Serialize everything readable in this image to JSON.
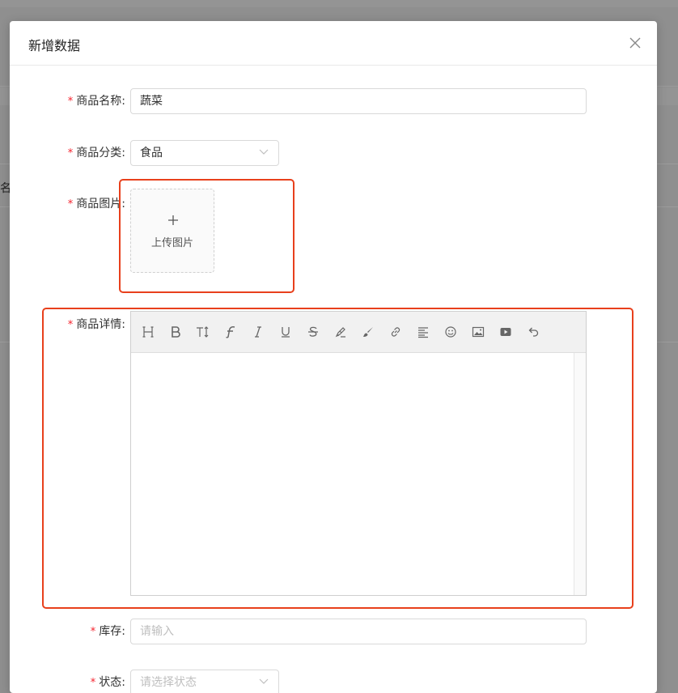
{
  "backdrop": {
    "fragment_text": "名"
  },
  "modal": {
    "title": "新增数据",
    "close_icon": "close-icon"
  },
  "form": {
    "required_mark": "*",
    "name": {
      "label": "商品名称:",
      "value": "蔬菜"
    },
    "category": {
      "label": "商品分类:",
      "value": "食品",
      "icon": "chevron-down-icon"
    },
    "image": {
      "label": "商品图片:",
      "upload_icon": "plus-icon",
      "upload_text": "上传图片"
    },
    "detail": {
      "label": "商品详情:",
      "toolbar": [
        "heading",
        "bold",
        "font-size",
        "font-family",
        "italic",
        "underline",
        "strikethrough",
        "highlighter",
        "brush",
        "link",
        "align",
        "emoji",
        "image",
        "video",
        "undo"
      ]
    },
    "stock": {
      "label": "库存:",
      "placeholder": "请输入"
    },
    "status": {
      "label": "状态:",
      "placeholder": "请选择状态",
      "icon": "chevron-down-icon"
    }
  },
  "annotation_color": "#e8401c"
}
